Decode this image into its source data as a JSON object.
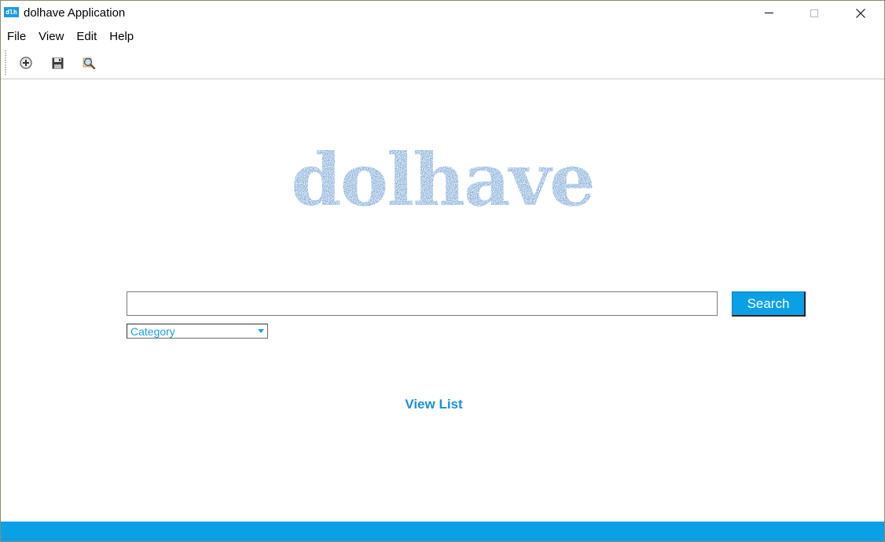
{
  "window": {
    "app_icon_text": "dlh",
    "title": "dolhave Application"
  },
  "menu": {
    "items": [
      {
        "label": "File"
      },
      {
        "label": "View"
      },
      {
        "label": "Edit"
      },
      {
        "label": "Help"
      }
    ]
  },
  "toolbar": {
    "buttons": [
      {
        "icon": "add-circle-icon"
      },
      {
        "icon": "save-icon"
      },
      {
        "icon": "search-magnifier-icon"
      }
    ]
  },
  "logo": {
    "text": "dolhave",
    "color": "#6f9fd0"
  },
  "search": {
    "value": "",
    "placeholder": "",
    "button_label": "Search"
  },
  "category": {
    "selected": "Category"
  },
  "links": {
    "view_list": "View List"
  },
  "colors": {
    "accent": "#0aa0e6",
    "link": "#1b8fd8",
    "statusbar": "#0aa0e6"
  }
}
